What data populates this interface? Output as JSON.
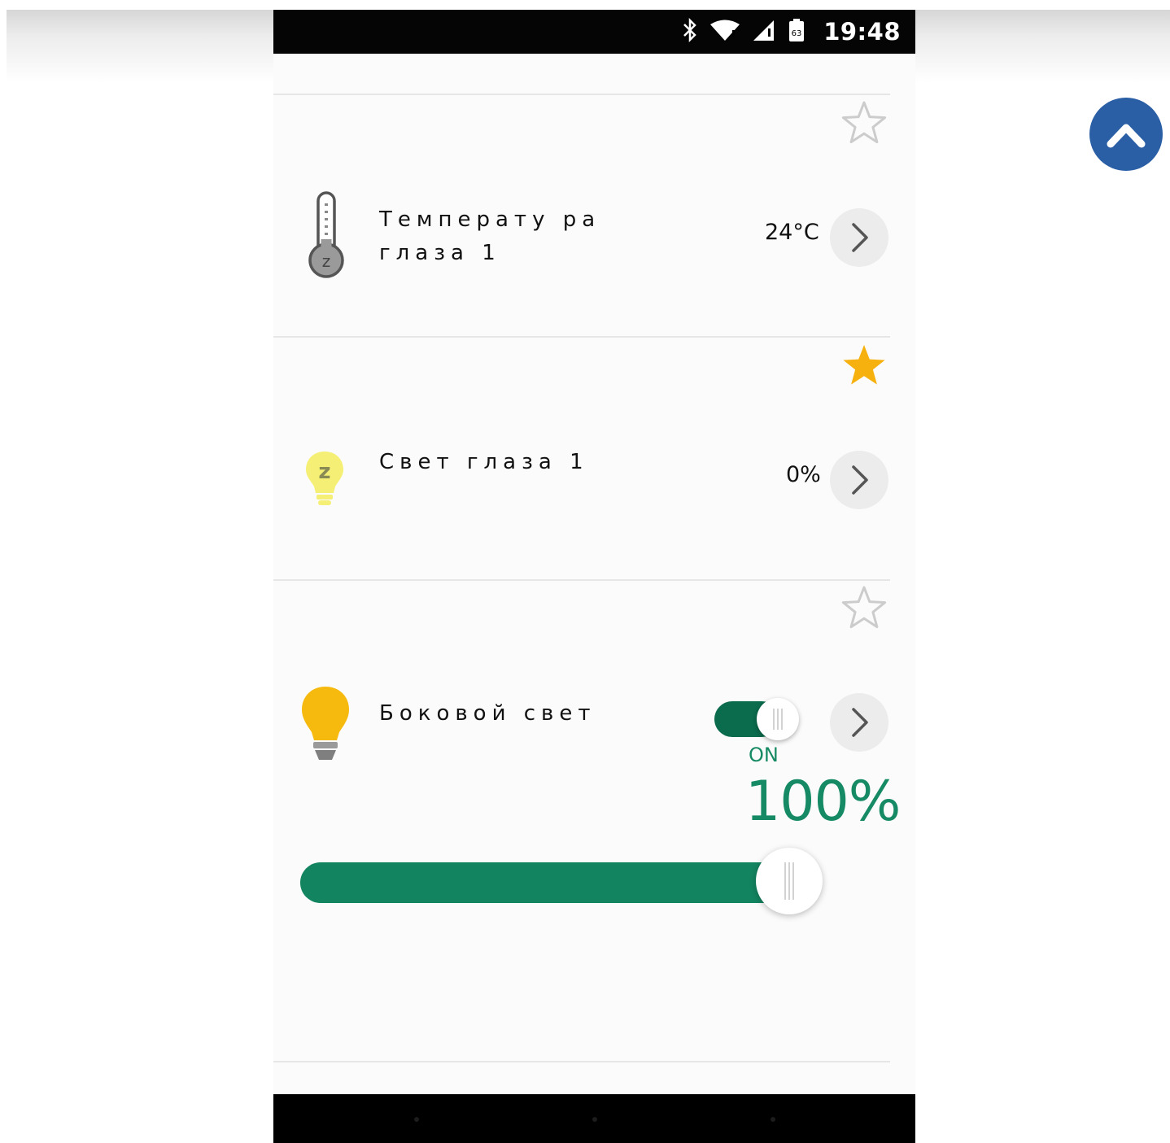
{
  "status_bar": {
    "time": "19:48",
    "battery_level": "63",
    "icons": [
      "bluetooth-icon",
      "wifi-icon",
      "signal-icon",
      "battery-icon"
    ]
  },
  "devices": [
    {
      "label": "Температу ра глаза 1",
      "value": "24°C",
      "favorite": false,
      "icon": "thermometer-icon"
    },
    {
      "label": "Свет глаза 1",
      "value": "0%",
      "favorite": true,
      "icon": "sleeping-bulb-icon"
    },
    {
      "label": "Боковой свет",
      "toggle_state_label": "ON",
      "level_label": "100%",
      "level": 100,
      "favorite": false,
      "icon": "bulb-icon"
    }
  ],
  "colors": {
    "accent_green": "#138460",
    "favorite_gold": "#f6b10f",
    "scroll_button_blue": "#2a5fa6"
  }
}
